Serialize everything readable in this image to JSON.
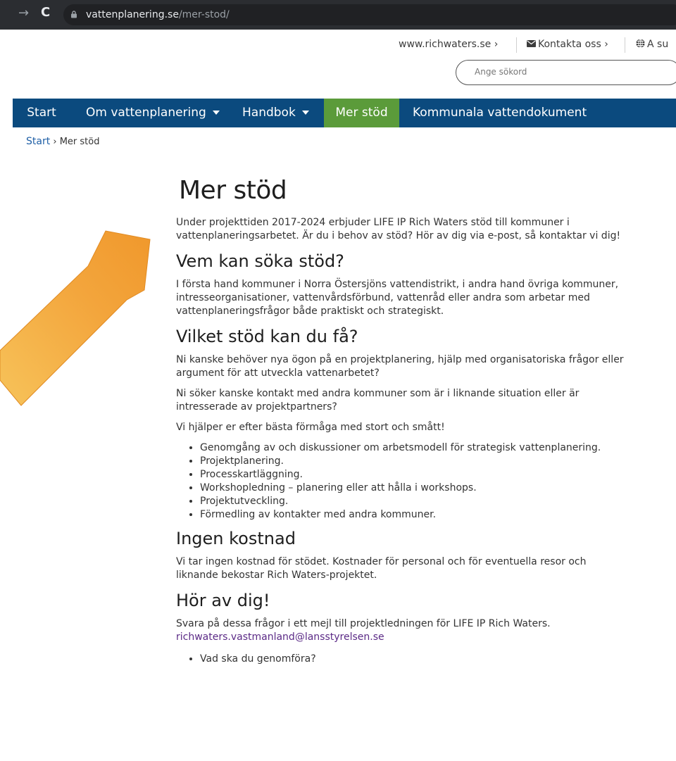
{
  "browser": {
    "url_host": "vattenplanering.se",
    "url_path": "/mer-stod/"
  },
  "utility": {
    "richwaters_link": "www.richwaters.se ›",
    "contact_link": "Kontakta oss ›",
    "language_link": "A su"
  },
  "search": {
    "placeholder": "Ange sökord"
  },
  "nav": {
    "items": [
      {
        "label": "Start"
      },
      {
        "label": "Om vattenplanering"
      },
      {
        "label": "Handbok"
      },
      {
        "label": "Mer stöd"
      },
      {
        "label": "Kommunala vattendokument"
      }
    ],
    "active_color": "#5b9b3a",
    "bar_color": "#0b4a7e"
  },
  "breadcrumb": {
    "home": "Start",
    "separator": "›",
    "current": "Mer stöd"
  },
  "page": {
    "title": "Mer stöd",
    "intro": "Under projekttiden 2017-2024 erbjuder LIFE IP Rich Waters stöd till kommuner i vattenplaneringsarbetet. Är du i behov av stöd? Hör av dig via e-post, så kontaktar vi dig!",
    "sections": {
      "who": {
        "heading": "Vem kan söka stöd?",
        "text": "I första hand kommuner i Norra Östersjöns vattendistrikt, i andra hand övriga kommuner, intresseorganisationer, vattenvårdsförbund, vattenråd eller andra som arbetar med vattenplaneringsfrågor både praktiskt och strategiskt."
      },
      "what": {
        "heading": "Vilket stöd kan du få?",
        "p1": "Ni kanske behöver nya ögon på en projektplanering, hjälp med organisatoriska frågor eller argument för att utveckla vattenarbetet?",
        "p2": "Ni söker kanske kontakt med andra kommuner som är i liknande situation eller är intresserade av projektpartners?",
        "p3": "Vi hjälper er efter bästa förmåga med stort och smått!",
        "list": [
          "Genomgång av och diskussioner om arbetsmodell för strategisk vattenplanering.",
          "Projektplanering.",
          "Processkartläggning.",
          "Workshopledning – planering eller att hålla i workshops.",
          "Projektutveckling.",
          "Förmedling av kontakter med andra kommuner."
        ]
      },
      "cost": {
        "heading": "Ingen kostnad",
        "text": "Vi tar ingen kostnad för stödet. Kostnader för personal och för eventuella resor och liknande bekostar Rich Waters-projektet."
      },
      "contact": {
        "heading": "Hör av dig!",
        "text": "Svara på dessa frågor i ett mejl till projektledningen för LIFE IP Rich Waters.",
        "email": "richwaters.vastmanland@lansstyrelsen.se",
        "list": [
          "Vad ska du genomföra?"
        ]
      }
    }
  }
}
